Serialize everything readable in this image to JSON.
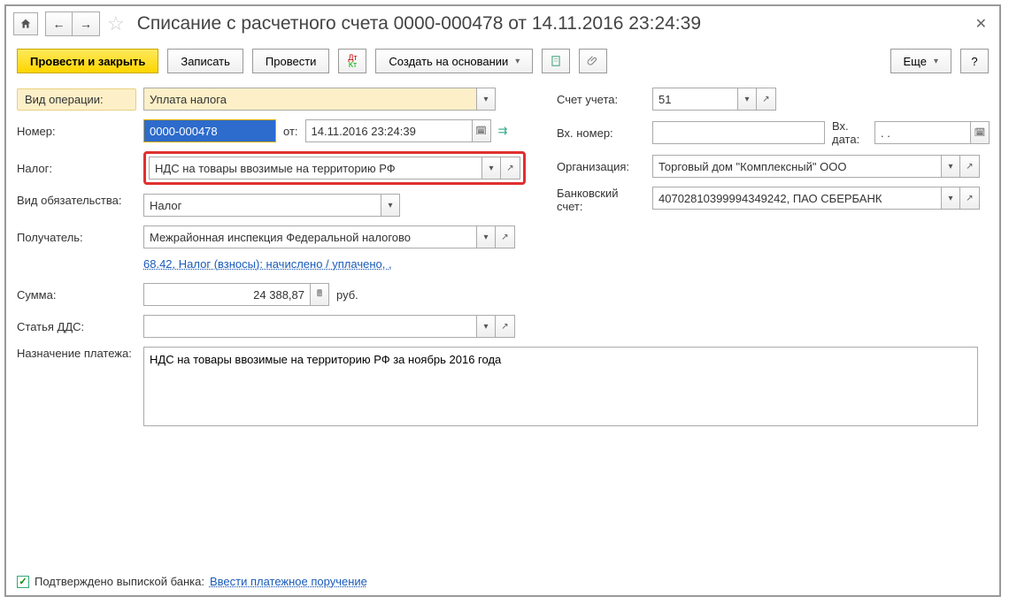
{
  "title": "Списание с расчетного счета 0000-000478 от 14.11.2016 23:24:39",
  "toolbar": {
    "post_close": "Провести и закрыть",
    "save": "Записать",
    "post": "Провести",
    "create_based": "Создать на основании",
    "more": "Еще"
  },
  "labels": {
    "op_type": "Вид операции:",
    "number": "Номер:",
    "from": "от:",
    "tax": "Налог:",
    "obligation": "Вид обязательства:",
    "recipient": "Получатель:",
    "sum": "Сумма:",
    "rub": "руб.",
    "dds": "Статья ДДС:",
    "purpose": "Назначение платежа:",
    "account": "Счет учета:",
    "in_number": "Вх. номер:",
    "in_date": "Вх. дата:",
    "org": "Организация:",
    "bank_acc": "Банковский счет:",
    "confirmed": "Подтверждено выпиской банка:",
    "enter_payment": "Ввести платежное поручение"
  },
  "values": {
    "op_type": "Уплата налога",
    "number": "0000-000478",
    "date": "14.11.2016 23:24:39",
    "tax": "НДС на товары ввозимые на территорию РФ",
    "obligation": "Налог",
    "recipient": "Межрайонная инспекция Федеральной налогово",
    "link": "68.42, Налог (взносы): начислено / уплачено, ,",
    "sum": "24 388,87",
    "dds": "",
    "purpose": "НДС на товары ввозимые на территорию РФ за ноябрь 2016 года",
    "account": "51",
    "in_number": "",
    "in_date": ".  .",
    "org": "Торговый дом \"Комплексный\" ООО",
    "bank_acc": "40702810399994349242, ПАО СБЕРБАНК"
  }
}
